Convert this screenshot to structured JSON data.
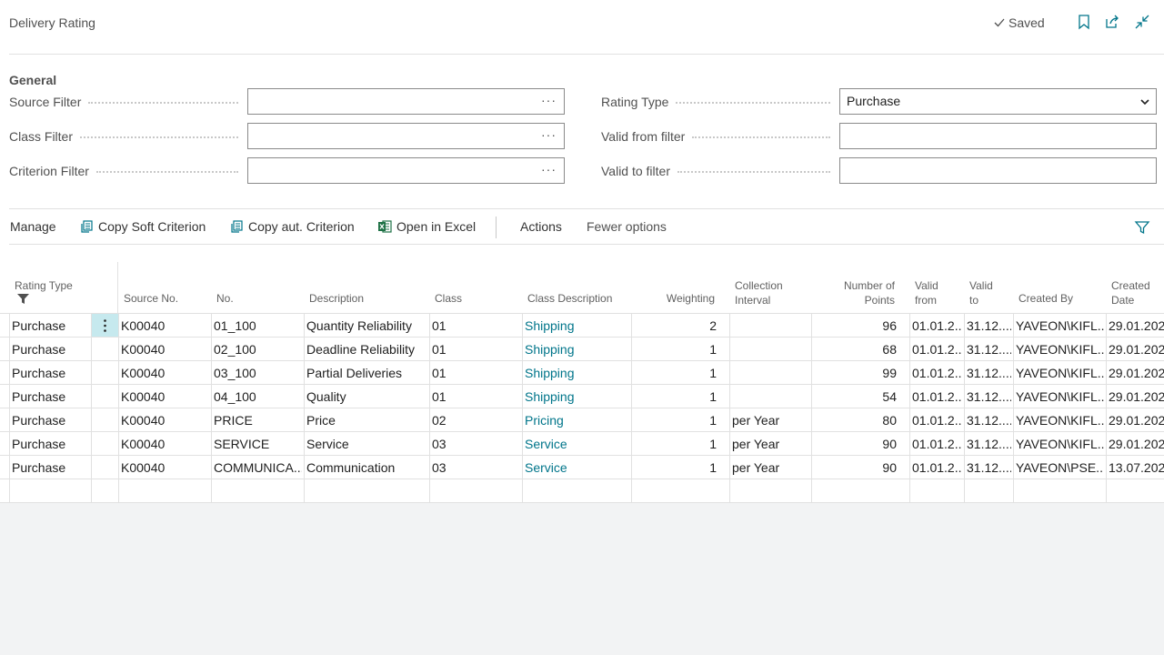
{
  "header": {
    "title": "Delivery Rating",
    "saved_label": "Saved",
    "icons": [
      "bookmark-icon",
      "open-new-window-icon",
      "collapse-icon"
    ]
  },
  "general": {
    "section_title": "General",
    "source_filter_label": "Source Filter",
    "class_filter_label": "Class Filter",
    "criterion_filter_label": "Criterion Filter",
    "rating_type_label": "Rating Type",
    "rating_type_value": "Purchase",
    "valid_from_label": "Valid from filter",
    "valid_to_label": "Valid to filter",
    "ellipsis": "···"
  },
  "actions": {
    "manage": "Manage",
    "copy_soft": "Copy Soft Criterion",
    "copy_aut": "Copy aut. Criterion",
    "open_excel": "Open in Excel",
    "actions": "Actions",
    "fewer_options": "Fewer options"
  },
  "table": {
    "headers": {
      "rating_type": "Rating Type",
      "source_no": "Source No.",
      "no": "No.",
      "description": "Description",
      "class": "Class",
      "class_description": "Class Description",
      "weighting": "Weighting",
      "collection_interval_1": "Collection",
      "collection_interval_2": "Interval",
      "number_of_points_1": "Number of",
      "number_of_points_2": "Points",
      "valid_from_1": "Valid",
      "valid_from_2": "from",
      "valid_to_1": "Valid",
      "valid_to_2": "to",
      "created_by": "Created By",
      "created_date_1": "Created",
      "created_date_2": "Date"
    },
    "rows": [
      {
        "rating_type": "Purchase",
        "source_no": "K00040",
        "no": "01_100",
        "description": "Quantity Reliability",
        "class": "01",
        "class_description": "Shipping",
        "weighting": "2",
        "collection_interval": "",
        "points": "96",
        "valid_from": "01.01.2...",
        "valid_to": "31.12....",
        "created_by": "YAVEON\\KIFL...",
        "created_date": "29.01.202"
      },
      {
        "rating_type": "Purchase",
        "source_no": "K00040",
        "no": "02_100",
        "description": "Deadline Reliability",
        "class": "01",
        "class_description": "Shipping",
        "weighting": "1",
        "collection_interval": "",
        "points": "68",
        "valid_from": "01.01.2...",
        "valid_to": "31.12....",
        "created_by": "YAVEON\\KIFL...",
        "created_date": "29.01.202"
      },
      {
        "rating_type": "Purchase",
        "source_no": "K00040",
        "no": "03_100",
        "description": "Partial Deliveries",
        "class": "01",
        "class_description": "Shipping",
        "weighting": "1",
        "collection_interval": "",
        "points": "99",
        "valid_from": "01.01.2...",
        "valid_to": "31.12....",
        "created_by": "YAVEON\\KIFL...",
        "created_date": "29.01.202"
      },
      {
        "rating_type": "Purchase",
        "source_no": "K00040",
        "no": "04_100",
        "description": "Quality",
        "class": "01",
        "class_description": "Shipping",
        "weighting": "1",
        "collection_interval": "",
        "points": "54",
        "valid_from": "01.01.2...",
        "valid_to": "31.12....",
        "created_by": "YAVEON\\KIFL...",
        "created_date": "29.01.202"
      },
      {
        "rating_type": "Purchase",
        "source_no": "K00040",
        "no": "PRICE",
        "description": "Price",
        "class": "02",
        "class_description": "Pricing",
        "weighting": "1",
        "collection_interval": "per Year",
        "points": "80",
        "valid_from": "01.01.2...",
        "valid_to": "31.12....",
        "created_by": "YAVEON\\KIFL...",
        "created_date": "29.01.202"
      },
      {
        "rating_type": "Purchase",
        "source_no": "K00040",
        "no": "SERVICE",
        "description": "Service",
        "class": "03",
        "class_description": "Service",
        "weighting": "1",
        "collection_interval": "per Year",
        "points": "90",
        "valid_from": "01.01.2...",
        "valid_to": "31.12....",
        "created_by": "YAVEON\\KIFL...",
        "created_date": "29.01.202"
      },
      {
        "rating_type": "Purchase",
        "source_no": "K00040",
        "no": "COMMUNICA...",
        "description": "Communication",
        "class": "03",
        "class_description": "Service",
        "weighting": "1",
        "collection_interval": "per Year",
        "points": "90",
        "valid_from": "01.01.2...",
        "valid_to": "31.12....",
        "created_by": "YAVEON\\PSE...",
        "created_date": "13.07.202"
      }
    ]
  },
  "colors": {
    "link": "#00758a",
    "selected_cell": "#c6e9ee",
    "accent": "#00a3b4",
    "excel_green": "#1e7145"
  }
}
